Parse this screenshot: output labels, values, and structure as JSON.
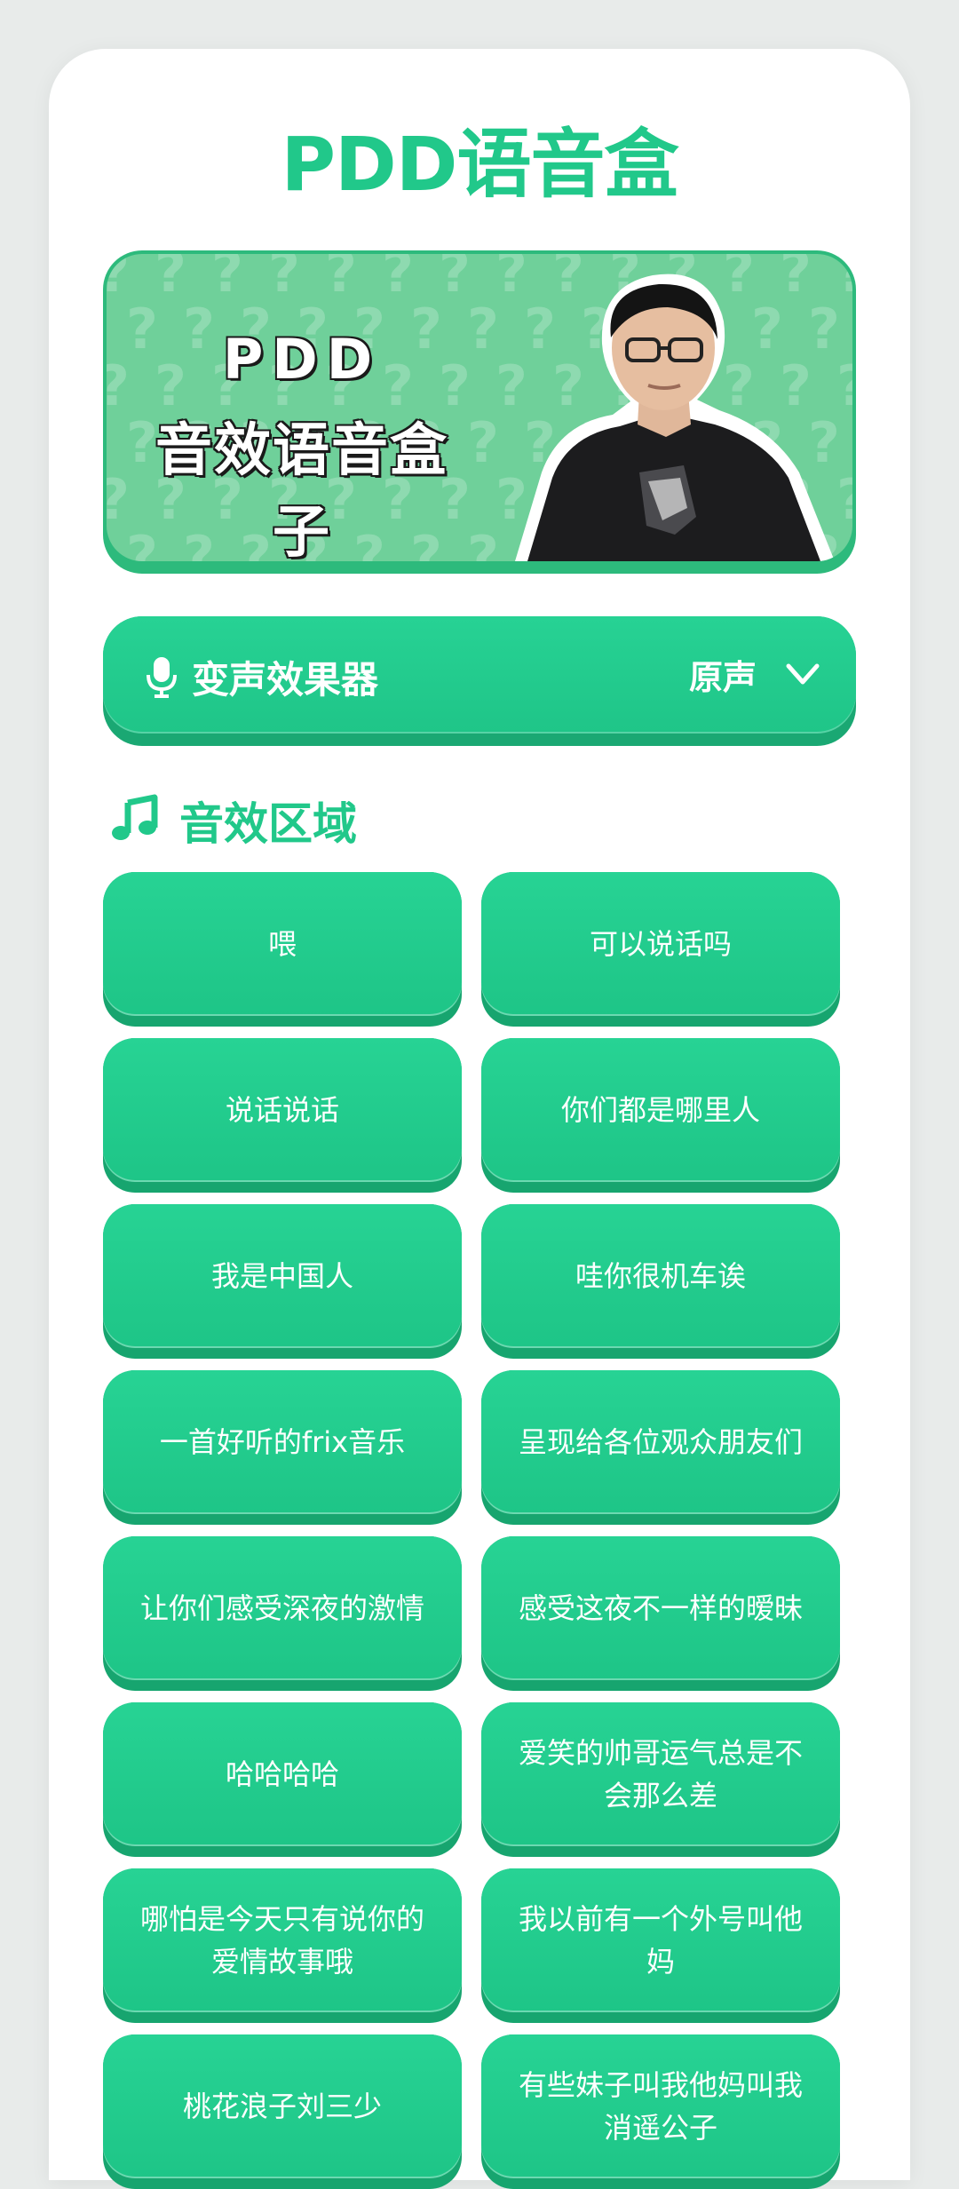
{
  "header": {
    "title": "PDD语音盒"
  },
  "banner": {
    "line1": "PDD",
    "line2": "音效语音盒子"
  },
  "voice_changer": {
    "label": "变声效果器",
    "value": "原声"
  },
  "sound_section": {
    "title": "音效区域",
    "items": [
      "喂",
      "可以说话吗",
      "说话说话",
      "你们都是哪里人",
      "我是中国人",
      "哇你很机车诶",
      "一首好听的frix音乐",
      "呈现给各位观众朋友们",
      "让你们感受深夜的激情",
      "感受这夜不一样的暧昧",
      "哈哈哈哈",
      "爱笑的帅哥运气总是不会那么差",
      "哪怕是今天只有说你的爱情故事哦",
      "我以前有一个外号叫他妈",
      "桃花浪子刘三少",
      "有些妹子叫我他妈叫我消遥公子"
    ]
  },
  "colors": {
    "accent": "#21c88a",
    "button": "#22cc8c",
    "button_shadow": "#17a56f",
    "banner_bg": "#6fd09a"
  },
  "icons": {
    "voice": "microphone-icon",
    "dropdown": "chevron-down-icon",
    "section": "music-note-icon"
  }
}
